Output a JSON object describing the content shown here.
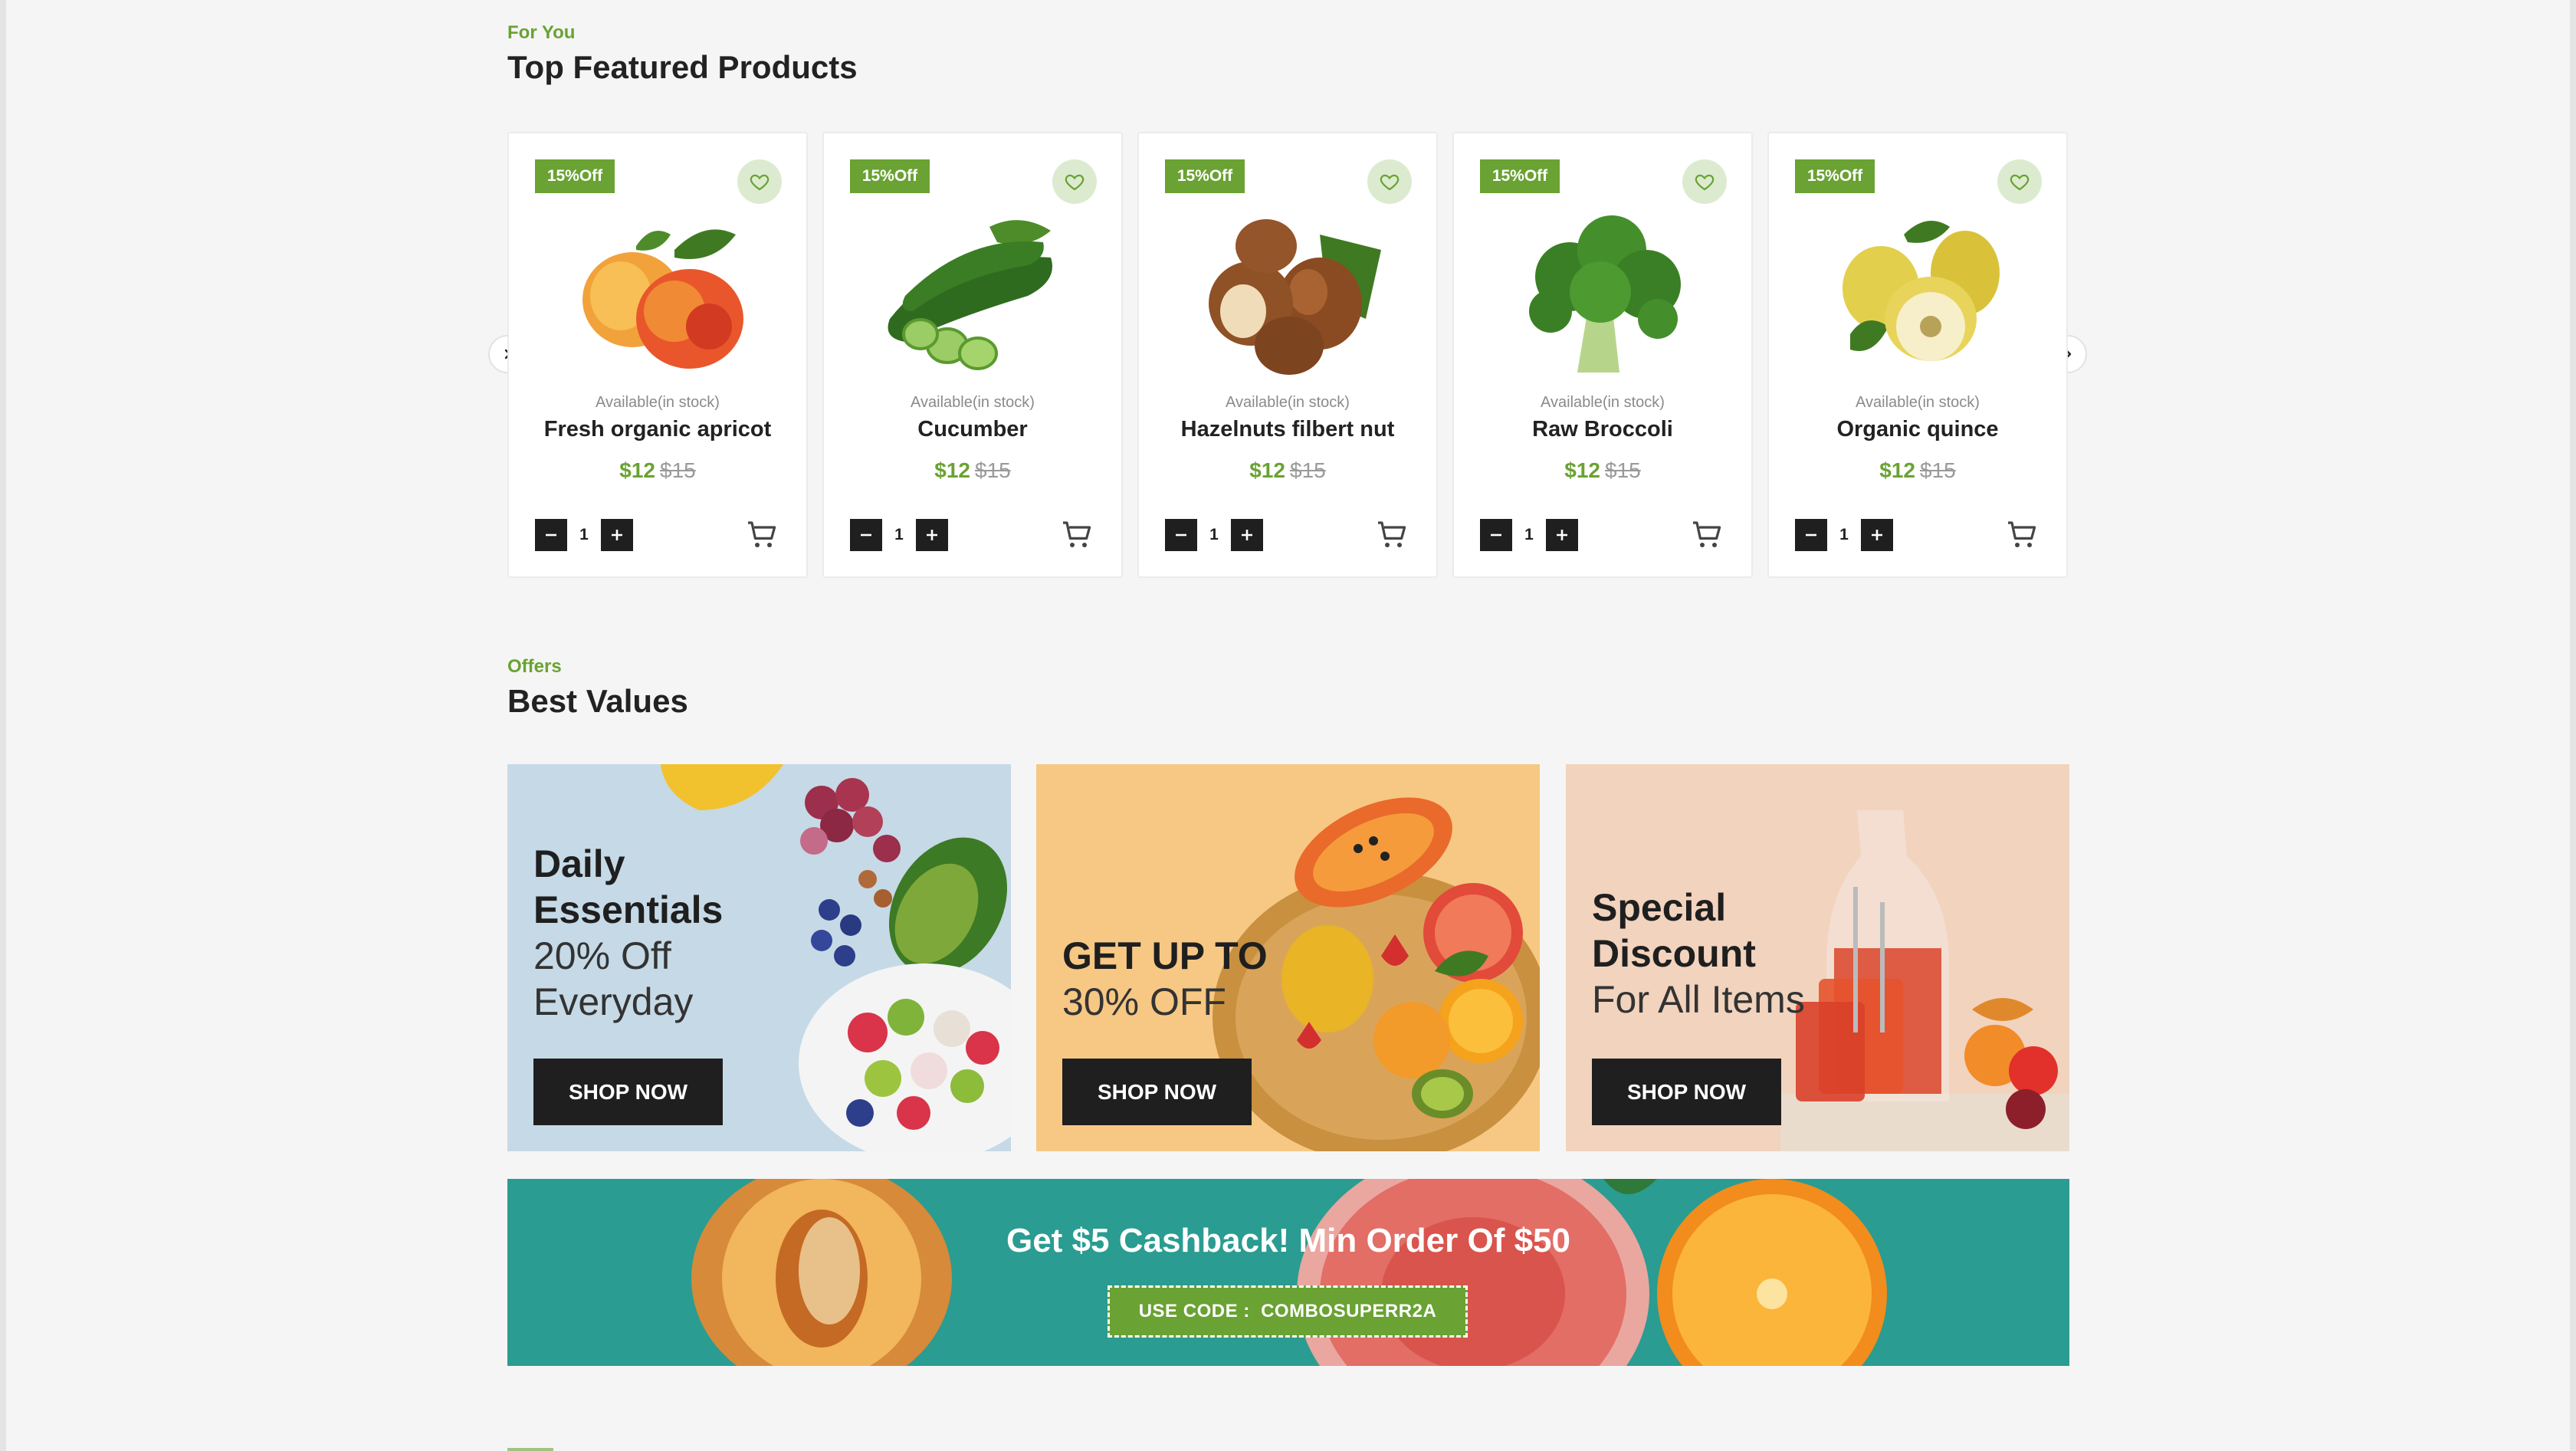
{
  "featured": {
    "eyebrow": "For You",
    "title": "Top Featured Products",
    "products": [
      {
        "badge": "15%Off",
        "stock": "Available(in stock)",
        "name": "Fresh organic apricot",
        "price": "$12",
        "old_price": "$15",
        "qty": "1",
        "image": "apricot"
      },
      {
        "badge": "15%Off",
        "stock": "Available(in stock)",
        "name": "Cucumber",
        "price": "$12",
        "old_price": "$15",
        "qty": "1",
        "image": "cucumber"
      },
      {
        "badge": "15%Off",
        "stock": "Available(in stock)",
        "name": "Hazelnuts filbert nut",
        "price": "$12",
        "old_price": "$15",
        "qty": "1",
        "image": "hazelnut"
      },
      {
        "badge": "15%Off",
        "stock": "Available(in stock)",
        "name": "Raw Broccoli",
        "price": "$12",
        "old_price": "$15",
        "qty": "1",
        "image": "broccoli"
      },
      {
        "badge": "15%Off",
        "stock": "Available(in stock)",
        "name": "Organic quince",
        "price": "$12",
        "old_price": "$15",
        "qty": "1",
        "image": "quince"
      }
    ]
  },
  "offers": {
    "eyebrow": "Offers",
    "title": "Best Values",
    "tiles": [
      {
        "line1": "Daily",
        "line2": "Essentials",
        "line3": "20% Off",
        "line4": "Everyday",
        "button": "SHOP NOW"
      },
      {
        "line1": "GET UP TO",
        "line2": "30% OFF",
        "button": "SHOP NOW"
      },
      {
        "line1": "Special",
        "line2": "Discount",
        "line3": "For All Items",
        "button": "SHOP NOW"
      }
    ]
  },
  "cashback": {
    "title": "Get $5 Cashback! Min Order Of $50",
    "code_label": "USE CODE :",
    "code": "COMBOSUPERR2A"
  },
  "colors": {
    "accent": "#6aa233",
    "dark": "#1f1f1f",
    "banner": "#2b9d92",
    "background": "#f5f5f5"
  },
  "icons": [
    "heart-icon",
    "cart-icon",
    "minus-icon",
    "plus-icon",
    "chevron-right-icon"
  ]
}
